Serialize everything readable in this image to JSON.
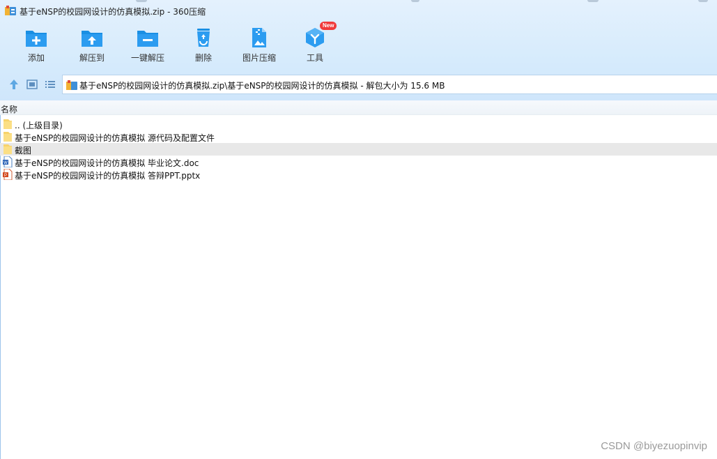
{
  "window": {
    "title": "基于eNSP的校园网设计的仿真模拟.zip - 360压缩"
  },
  "toolbar": {
    "items": [
      {
        "label": "添加",
        "icon": "folder-add-icon"
      },
      {
        "label": "解压到",
        "icon": "folder-extract-icon"
      },
      {
        "label": "一键解压",
        "icon": "folder-oneclick-extract-icon"
      },
      {
        "label": "删除",
        "icon": "recycle-bin-icon"
      },
      {
        "label": "图片压缩",
        "icon": "image-compress-icon"
      },
      {
        "label": "工具",
        "icon": "tools-cube-icon",
        "badge": "New"
      }
    ]
  },
  "navigation": {
    "path": "基于eNSP的校园网设计的仿真模拟.zip\\基于eNSP的校园网设计的仿真模拟 - 解包大小为 15.6 MB"
  },
  "list": {
    "column_name": "名称",
    "rows": [
      {
        "name": ".. (上级目录)",
        "type": "folder",
        "selected": false
      },
      {
        "name": "基于eNSP的校园网设计的仿真模拟 源代码及配置文件",
        "type": "folder",
        "selected": false
      },
      {
        "name": "截图",
        "type": "folder",
        "selected": true
      },
      {
        "name": "基于eNSP的校园网设计的仿真模拟 毕业论文.doc",
        "type": "doc",
        "selected": false
      },
      {
        "name": "基于eNSP的校园网设计的仿真模拟 答辩PPT.pptx",
        "type": "pptx",
        "selected": false
      }
    ]
  },
  "watermark": "CSDN @biyezuopinvip",
  "colors": {
    "accent": "#1a8fe3",
    "chrome_bg": "#d6ebfc",
    "selected_row": "#e8e8e8",
    "badge": "#f03a3a"
  }
}
